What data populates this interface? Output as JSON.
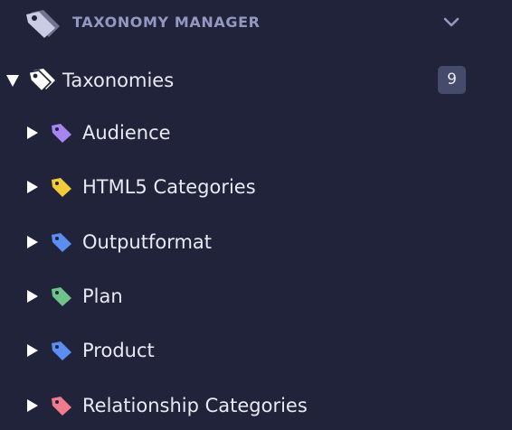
{
  "header": {
    "title": "TAXONOMY MANAGER",
    "icon": "tags-icon",
    "collapse_icon": "chevron-down-icon"
  },
  "tree": {
    "root": {
      "label": "Taxonomies",
      "count": "9",
      "expanded": true,
      "icon": "tags-icon"
    },
    "items": [
      {
        "label": "Audience",
        "color": "#a685f0"
      },
      {
        "label": "HTML5 Categories",
        "color": "#f2cb3a"
      },
      {
        "label": "Outputformat",
        "color": "#5b8ef0"
      },
      {
        "label": "Plan",
        "color": "#6fc28a"
      },
      {
        "label": "Product",
        "color": "#5b8ef0"
      },
      {
        "label": "Relationship Categories",
        "color": "#f07a8e"
      }
    ]
  },
  "colors": {
    "background": "#21233a",
    "header_text": "#9498c0",
    "item_text": "#e8e9f3",
    "badge_bg": "#474b6b"
  }
}
